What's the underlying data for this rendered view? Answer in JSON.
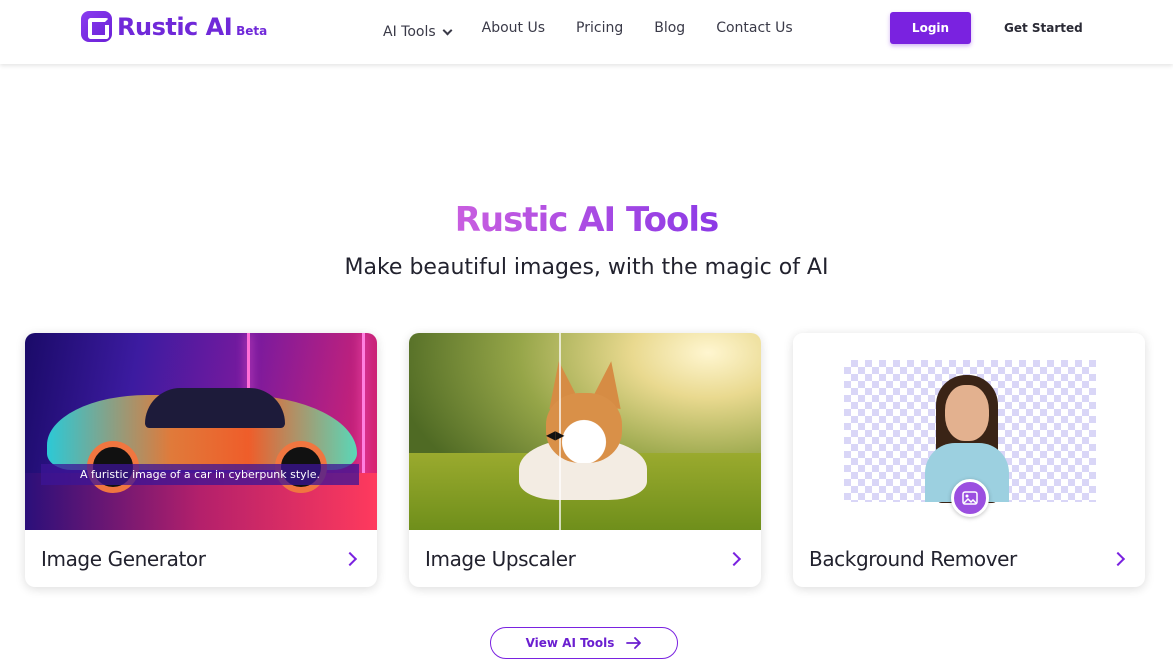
{
  "brand": {
    "name": "Rustic AI",
    "badge": "Beta",
    "accent": "#7a22e0"
  },
  "nav": {
    "items": [
      {
        "label": "AI Tools",
        "has_dropdown": true
      },
      {
        "label": "About Us"
      },
      {
        "label": "Pricing"
      },
      {
        "label": "Blog"
      },
      {
        "label": "Contact Us"
      }
    ],
    "login_label": "Login",
    "get_started_label": "Get Started"
  },
  "hero": {
    "title": "Rustic AI Tools",
    "subtitle": "Make beautiful images, with the magic of AI"
  },
  "cards": [
    {
      "title": "Image Generator",
      "image_caption": "A furistic image of a car in cyberpunk style.",
      "icon": "chevron-right-icon"
    },
    {
      "title": "Image Upscaler",
      "icon": "chevron-right-icon"
    },
    {
      "title": "Background Remover",
      "icon": "chevron-right-icon"
    }
  ],
  "cta": {
    "label": "View AI Tools",
    "icon": "arrow-right-icon"
  }
}
